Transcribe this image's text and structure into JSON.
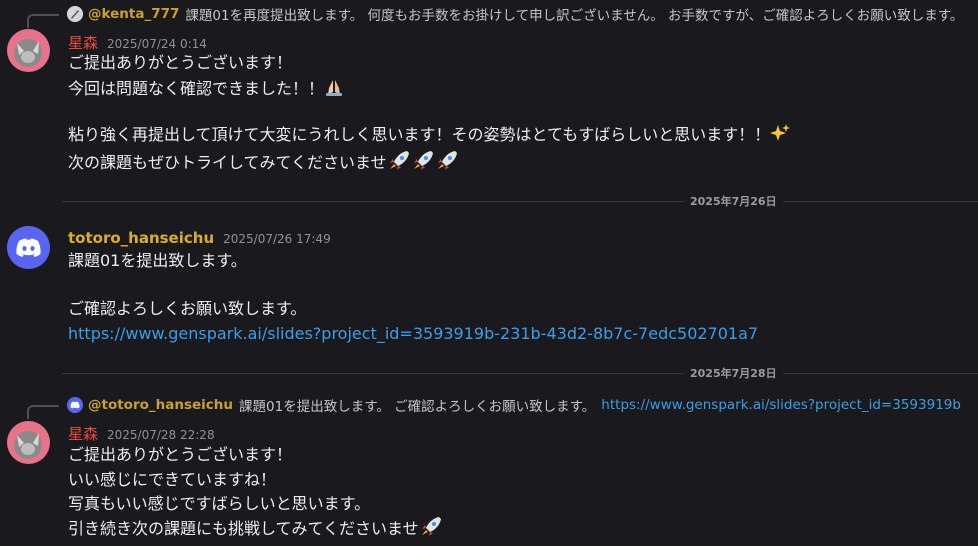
{
  "messages": [
    {
      "reply": {
        "author": "@kenta_777",
        "text": "課題01を再度提出致します。 何度もお手数をお掛けして申し訳ございません。 お手数ですが、ご確認よろしくお願い致します。"
      },
      "author": "星森",
      "timestamp": "2025/07/24 0:14",
      "lines": [
        "ご提出ありがとうございます！",
        "今回は問題なく確認できました！！",
        "",
        "粘り強く再提出して頂けて大変にうれしく思います！その姿勢はとてもすばらしいと思います！！",
        "次の課題もぜひトライしてみてくださいませ"
      ]
    },
    {
      "author": "totoro_hanseichu",
      "timestamp": "2025/07/26 17:49",
      "lines": [
        "課題01を提出致します。",
        "",
        "ご確認よろしくお願い致します。"
      ],
      "link": "https://www.genspark.ai/slides?project_id=3593919b-231b-43d2-8b7c-7edc502701a7"
    },
    {
      "reply": {
        "author": "@totoro_hanseichu",
        "text": "課題01を提出致します。 ご確認よろしくお願い致します。",
        "link": "https://www.genspark.ai/slides?project_id=3593919b"
      },
      "author": "星森",
      "timestamp": "2025/07/28 22:28",
      "lines": [
        "ご提出ありがとうございます！",
        "いい感じにできていますね！",
        "写真もいい感じですばらしいと思います。",
        "引き続き次の課題にも挑戦してみてくださいませ"
      ]
    }
  ],
  "dividers": [
    "2025年7月26日",
    "2025年7月28日"
  ],
  "icons": {
    "pray": "folded-hands-emoji",
    "sparkles": "sparkles-emoji",
    "rocket": "rocket-emoji",
    "discord": "discord-logo-icon"
  },
  "colors": {
    "background": "#1a1a1e",
    "author_red": "#e9493f",
    "author_gold": "#dcae24",
    "link": "#3b9ee8",
    "discord_blurple": "#5865f2"
  }
}
